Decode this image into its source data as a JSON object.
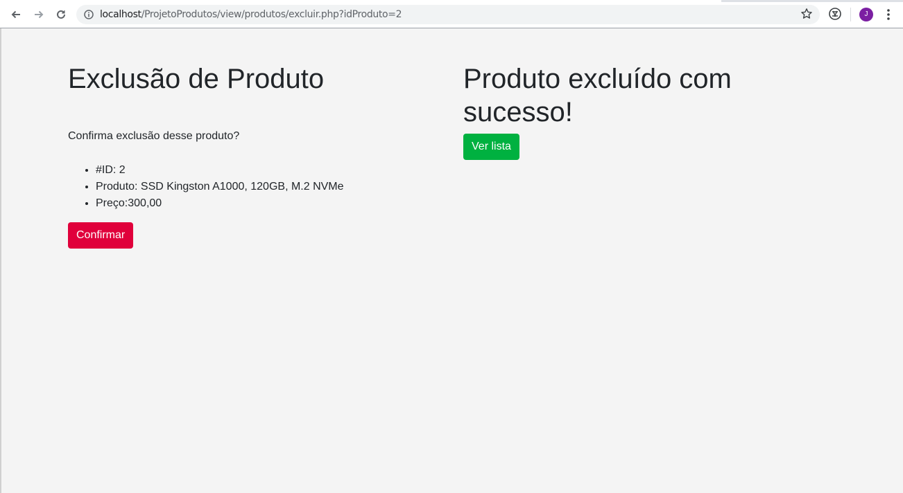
{
  "browser": {
    "url_host": "localhost",
    "url_path": "/ProjetoProdutos/view/produtos/excluir.php?idProduto=2",
    "avatar_initial": "J"
  },
  "left": {
    "title": "Exclusão de Produto",
    "confirm_text": "Confirma exclusão desse produto?",
    "items": [
      "#ID: 2",
      "Produto: SSD Kingston A1000, 120GB, M.2 NVMe",
      "Preço:300,00"
    ],
    "confirm_button": "Confirmar"
  },
  "right": {
    "title": "Produto excluído com sucesso!",
    "list_button": "Ver lista"
  },
  "colors": {
    "danger": "#e0003b",
    "success": "#00b140",
    "avatar": "#7b1fa2"
  }
}
